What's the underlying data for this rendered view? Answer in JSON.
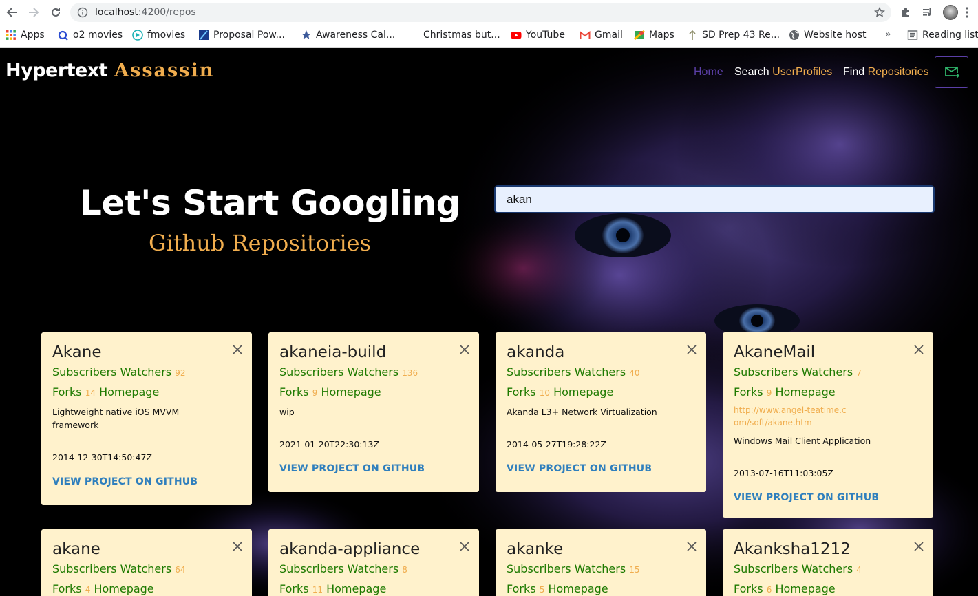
{
  "browser": {
    "url_host": "localhost",
    "url_path": ":4200/repos",
    "bookmarks": [
      {
        "label": "Apps",
        "icon": "apps-grid-icon"
      },
      {
        "label": "o2 movies",
        "icon": "o2-icon"
      },
      {
        "label": "fmovies",
        "icon": "play-icon"
      },
      {
        "label": "Proposal Pow...",
        "icon": "proposal-icon"
      },
      {
        "label": "Awareness Cal...",
        "icon": "star-icon"
      },
      {
        "label": "Christmas but...",
        "icon": "blank-icon"
      },
      {
        "label": "YouTube",
        "icon": "youtube-icon"
      },
      {
        "label": "Gmail",
        "icon": "gmail-icon"
      },
      {
        "label": "Maps",
        "icon": "maps-icon"
      },
      {
        "label": "SD Prep 43 Re...",
        "icon": "sd-icon"
      },
      {
        "label": "Website host",
        "icon": "globe-icon"
      }
    ],
    "more": "»",
    "reading_list": "Reading list"
  },
  "navbar": {
    "brand_main": "Hypertext",
    "brand_accent": "Assassin",
    "home": "Home",
    "search_white": "Search",
    "search_orange": "UserProfiles",
    "find_white": "Find",
    "find_orange": "Repositories"
  },
  "hero": {
    "title": "Let's Start Googling",
    "subtitle": "Github Repositories"
  },
  "search": {
    "value": "akan"
  },
  "labels": {
    "subscribers": "Subscribers Watchers",
    "forks": "Forks",
    "homepage": "Homepage",
    "view": "VIEW PROJECT ON GITHUB"
  },
  "repos": [
    {
      "name": "Akane",
      "watchers": "92",
      "forks": "14",
      "homepage_url": "",
      "description": "Lightweight native iOS MVVM framework",
      "date": "2014-12-30T14:50:47Z"
    },
    {
      "name": "akaneia-build",
      "watchers": "136",
      "forks": "9",
      "homepage_url": "",
      "description": "wip",
      "date": "2021-01-20T22:30:13Z"
    },
    {
      "name": "akanda",
      "watchers": "40",
      "forks": "10",
      "homepage_url": "",
      "description": "Akanda L3+ Network Virtualization",
      "date": "2014-05-27T19:28:22Z"
    },
    {
      "name": "AkaneMail",
      "watchers": "7",
      "forks": "9",
      "homepage_url": "http://www.angel-teatime.com/soft/akane.htm",
      "description": "Windows Mail Client Application",
      "date": "2013-07-16T11:03:05Z"
    },
    {
      "name": "akane",
      "watchers": "64",
      "forks": "4",
      "homepage_url": "",
      "description": "",
      "date": ""
    },
    {
      "name": "akanda-appliance",
      "watchers": "8",
      "forks": "11",
      "homepage_url": "",
      "description": "",
      "date": ""
    },
    {
      "name": "akanke",
      "watchers": "15",
      "forks": "5",
      "homepage_url": "",
      "description": "",
      "date": ""
    },
    {
      "name": "Akanksha1212",
      "watchers": "4",
      "forks": "6",
      "homepage_url": "",
      "description": "",
      "date": ""
    }
  ]
}
